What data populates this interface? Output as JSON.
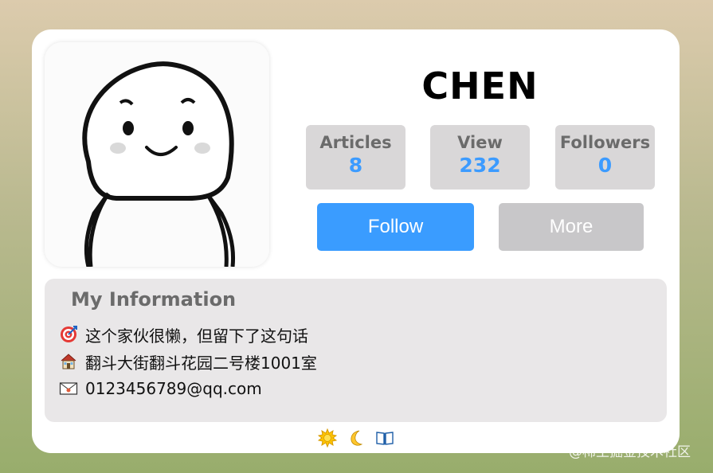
{
  "profile": {
    "name": "CHEN",
    "avatar_alt": "cartoon-avatar"
  },
  "stats": [
    {
      "label": "Articles",
      "value": "8"
    },
    {
      "label": "View",
      "value": "232"
    },
    {
      "label": "Followers",
      "value": "0"
    }
  ],
  "actions": {
    "follow_label": "Follow",
    "more_label": "More"
  },
  "info": {
    "title": "My Information",
    "items": [
      {
        "icon": "target-icon",
        "text": "这个家伙很懒，但留下了这句话"
      },
      {
        "icon": "house-icon",
        "text": "翻斗大街翻斗花园二号楼1001室"
      },
      {
        "icon": "envelope-icon",
        "text": "0123456789@qq.com"
      }
    ]
  },
  "footer": {
    "icons": [
      "sun-icon",
      "moon-icon",
      "book-icon"
    ]
  },
  "watermark": "@稀土掘金技术社区",
  "colors": {
    "accent": "#3a9cff",
    "stat_value": "#3c9bff",
    "stat_bg": "#d9d7d8",
    "more_bg": "#c8c7c9",
    "info_bg": "#e9e7e8"
  }
}
